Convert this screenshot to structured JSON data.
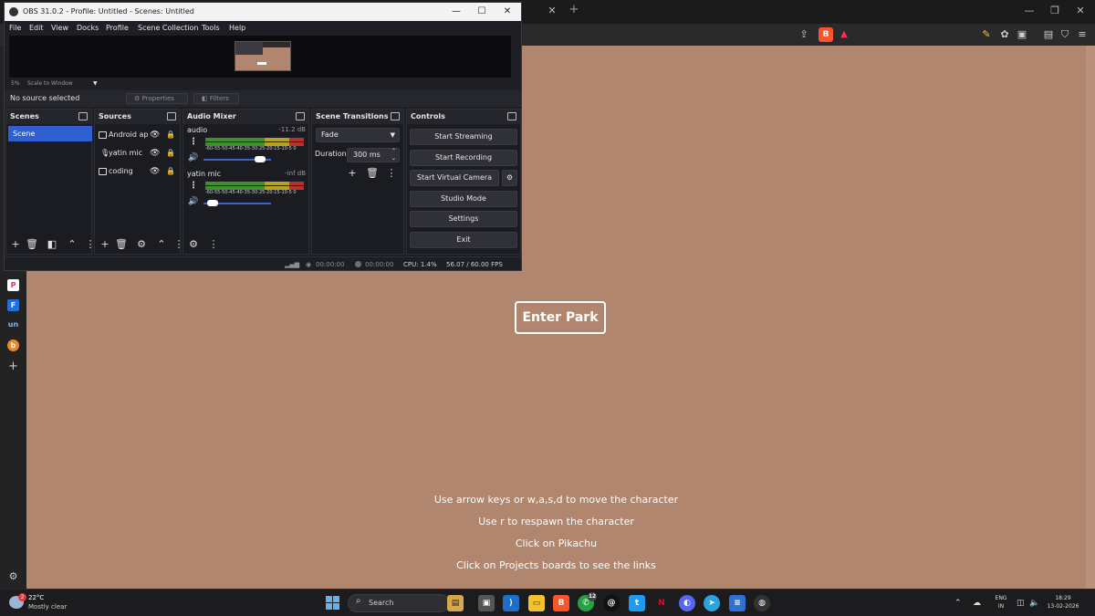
{
  "browser": {
    "tab_close": "✕",
    "tab_new": "+",
    "sidebar_apps": [
      {
        "label": "P",
        "color": "#ffffff",
        "text_color": "#e1306c"
      },
      {
        "label": "F",
        "color": "#1f6fe0",
        "text_color": "#ffffff"
      },
      {
        "label": "un",
        "color": "#232323",
        "text_color": "#7fb3ff"
      },
      {
        "label": "b",
        "color": "#f0862a",
        "text_color": "#ffffff"
      }
    ],
    "sidebar_add": "+",
    "page_bg": "#b0866f"
  },
  "page": {
    "enter_button": "Enter Park",
    "instructions": [
      "Use arrow keys or w,a,s,d to move the character",
      "Use r to respawn the character",
      "Click on Pikachu",
      "Click on Projects boards to see the links"
    ]
  },
  "obs": {
    "title": "OBS 31.0.2 - Profile: Untitled - Scenes: Untitled",
    "menu": [
      "File",
      "Edit",
      "View",
      "Docks",
      "Profile",
      "Scene Collection",
      "Tools",
      "Help"
    ],
    "zoom_percent": "5%",
    "zoom_mode": "Scale to Window",
    "no_source": "No source selected",
    "properties_btn": "Properties",
    "filters_btn": "Filters",
    "docks": {
      "scenes": "Scenes",
      "sources": "Sources",
      "mixer": "Audio Mixer",
      "transitions": "Scene Transitions",
      "controls": "Controls"
    },
    "scenes": [
      "Scene"
    ],
    "sources": [
      {
        "name": "Android ap",
        "type": "display"
      },
      {
        "name": "yatin mic",
        "type": "mic"
      },
      {
        "name": "coding",
        "type": "display"
      }
    ],
    "mixer": [
      {
        "name": "audio",
        "db": "-11.2 dB",
        "volume": 0.9
      },
      {
        "name": "yatin mic",
        "db": "-inf dB",
        "volume": 0.06
      }
    ],
    "meter_scale": "-60-55-50-45-40-35-30-25-20-15-10-5 0",
    "transition": "Fade",
    "duration_label": "Duration",
    "duration_value": "300 ms",
    "controls": [
      "Start Streaming",
      "Start Recording",
      "Start Virtual Camera",
      "Studio Mode",
      "Settings",
      "Exit"
    ],
    "status": {
      "stream_time": "00:00:00",
      "rec_time": "00:00:00",
      "cpu": "CPU: 1.4%",
      "fps": "56.07 / 60.00 FPS"
    }
  },
  "taskbar": {
    "weather_badge": "2",
    "temp": "22°C",
    "condition": "Mostly clear",
    "search": "Search",
    "whatsapp_badge": "12",
    "lang_top": "ENG",
    "lang_bottom": "IN",
    "time": "18:29",
    "date": "13-02-2026"
  }
}
